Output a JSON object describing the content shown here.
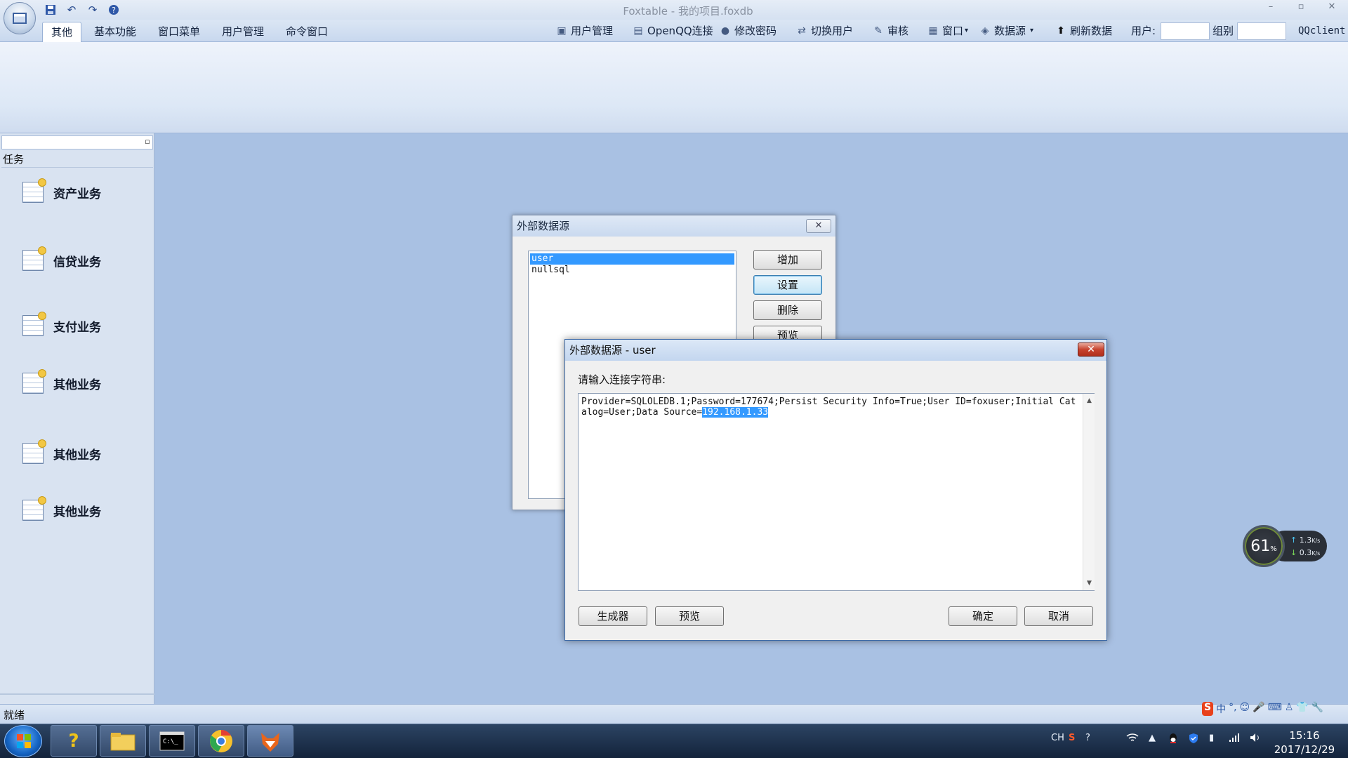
{
  "window": {
    "title": "Foxtable - 我的项目.foxdb",
    "minimize": "–",
    "maximize": "▫",
    "close": "✕"
  },
  "tabs": [
    {
      "label": "其他",
      "active": true
    },
    {
      "label": "基本功能",
      "active": false
    },
    {
      "label": "窗口菜单",
      "active": false
    },
    {
      "label": "用户管理",
      "active": false
    },
    {
      "label": "命令窗口",
      "active": false
    }
  ],
  "toolbar": {
    "user_mgmt": "用户管理",
    "openqq": "OpenQQ连接",
    "change_pwd": "修改密码",
    "switch_user": "切换用户",
    "audit": "审核",
    "window": "窗口",
    "datasource": "数据源",
    "refresh": "刷新数据",
    "user_label": "用户:",
    "group_label": "组别",
    "client": "QQclient",
    "dropdown_arrow": "▾"
  },
  "panel": {
    "title": "任务",
    "pin": "▫",
    "items": [
      "资产业务",
      "信贷业务",
      "支付业务",
      "其他业务",
      "其他业务",
      "其他业务"
    ]
  },
  "status": {
    "text": "就绪"
  },
  "ime": {
    "items": [
      "S",
      "中",
      "°,",
      "☺",
      "🎤",
      "⌨",
      "♙",
      "👕",
      "🔧"
    ]
  },
  "tray": {
    "lang": "CH",
    "time": "15:16",
    "date": "2017/12/29"
  },
  "netmon": {
    "cpu": "61",
    "cpu_unit": "%",
    "up": "1.3",
    "down": "0.3",
    "rate_unit": "K/s",
    "up_arrow": "↑",
    "down_arrow": "↓"
  },
  "dialog1": {
    "title": "外部数据源",
    "close": "✕",
    "list": [
      {
        "label": "user",
        "selected": true
      },
      {
        "label": "nullsql",
        "selected": false
      }
    ],
    "buttons": {
      "add": "增加",
      "settings": "设置",
      "delete": "删除",
      "preview": "预览"
    }
  },
  "dialog2": {
    "title": "外部数据源 - user",
    "close": "✕",
    "prompt": "请输入连接字符串:",
    "conn_string": "Provider=SQLOLEDB.1;Password=177674;Persist Security Info=True;User ID=foxuser;Initial Catalog=User;Data Source=",
    "conn_selected": "192.168.1.33",
    "scroll_up": "▲",
    "scroll_down": "▼",
    "buttons": {
      "generator": "生成器",
      "preview": "预览",
      "ok": "确定",
      "cancel": "取消"
    }
  },
  "colors": {
    "accent": "#3399ff",
    "background": "#a9c1e3"
  }
}
